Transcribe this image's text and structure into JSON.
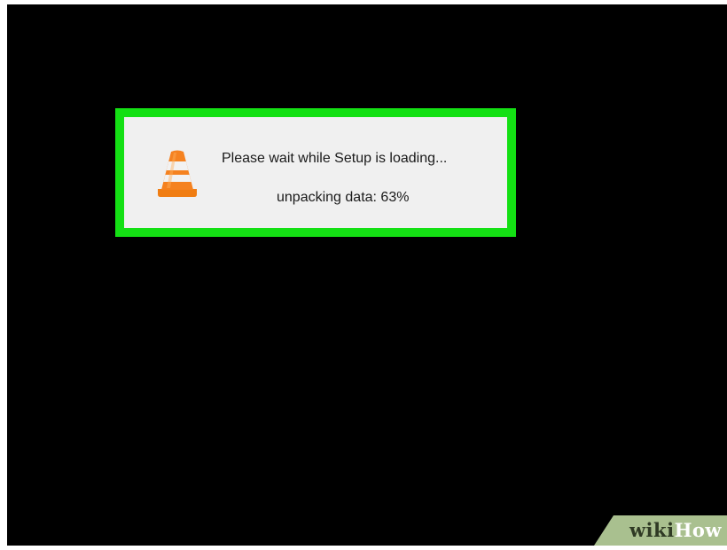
{
  "dialog": {
    "icon": "vlc-cone-icon",
    "message": "Please wait while Setup is loading...",
    "status": "unpacking data: 63%",
    "progress_percent": 63
  },
  "highlight": {
    "color": "#14e014"
  },
  "watermark": {
    "part1": "wiki",
    "part2": "How"
  },
  "colors": {
    "background": "#000000",
    "dialog_background": "#f0f0f0",
    "cone_orange": "#f58220",
    "watermark_green": "#a9c08f"
  }
}
